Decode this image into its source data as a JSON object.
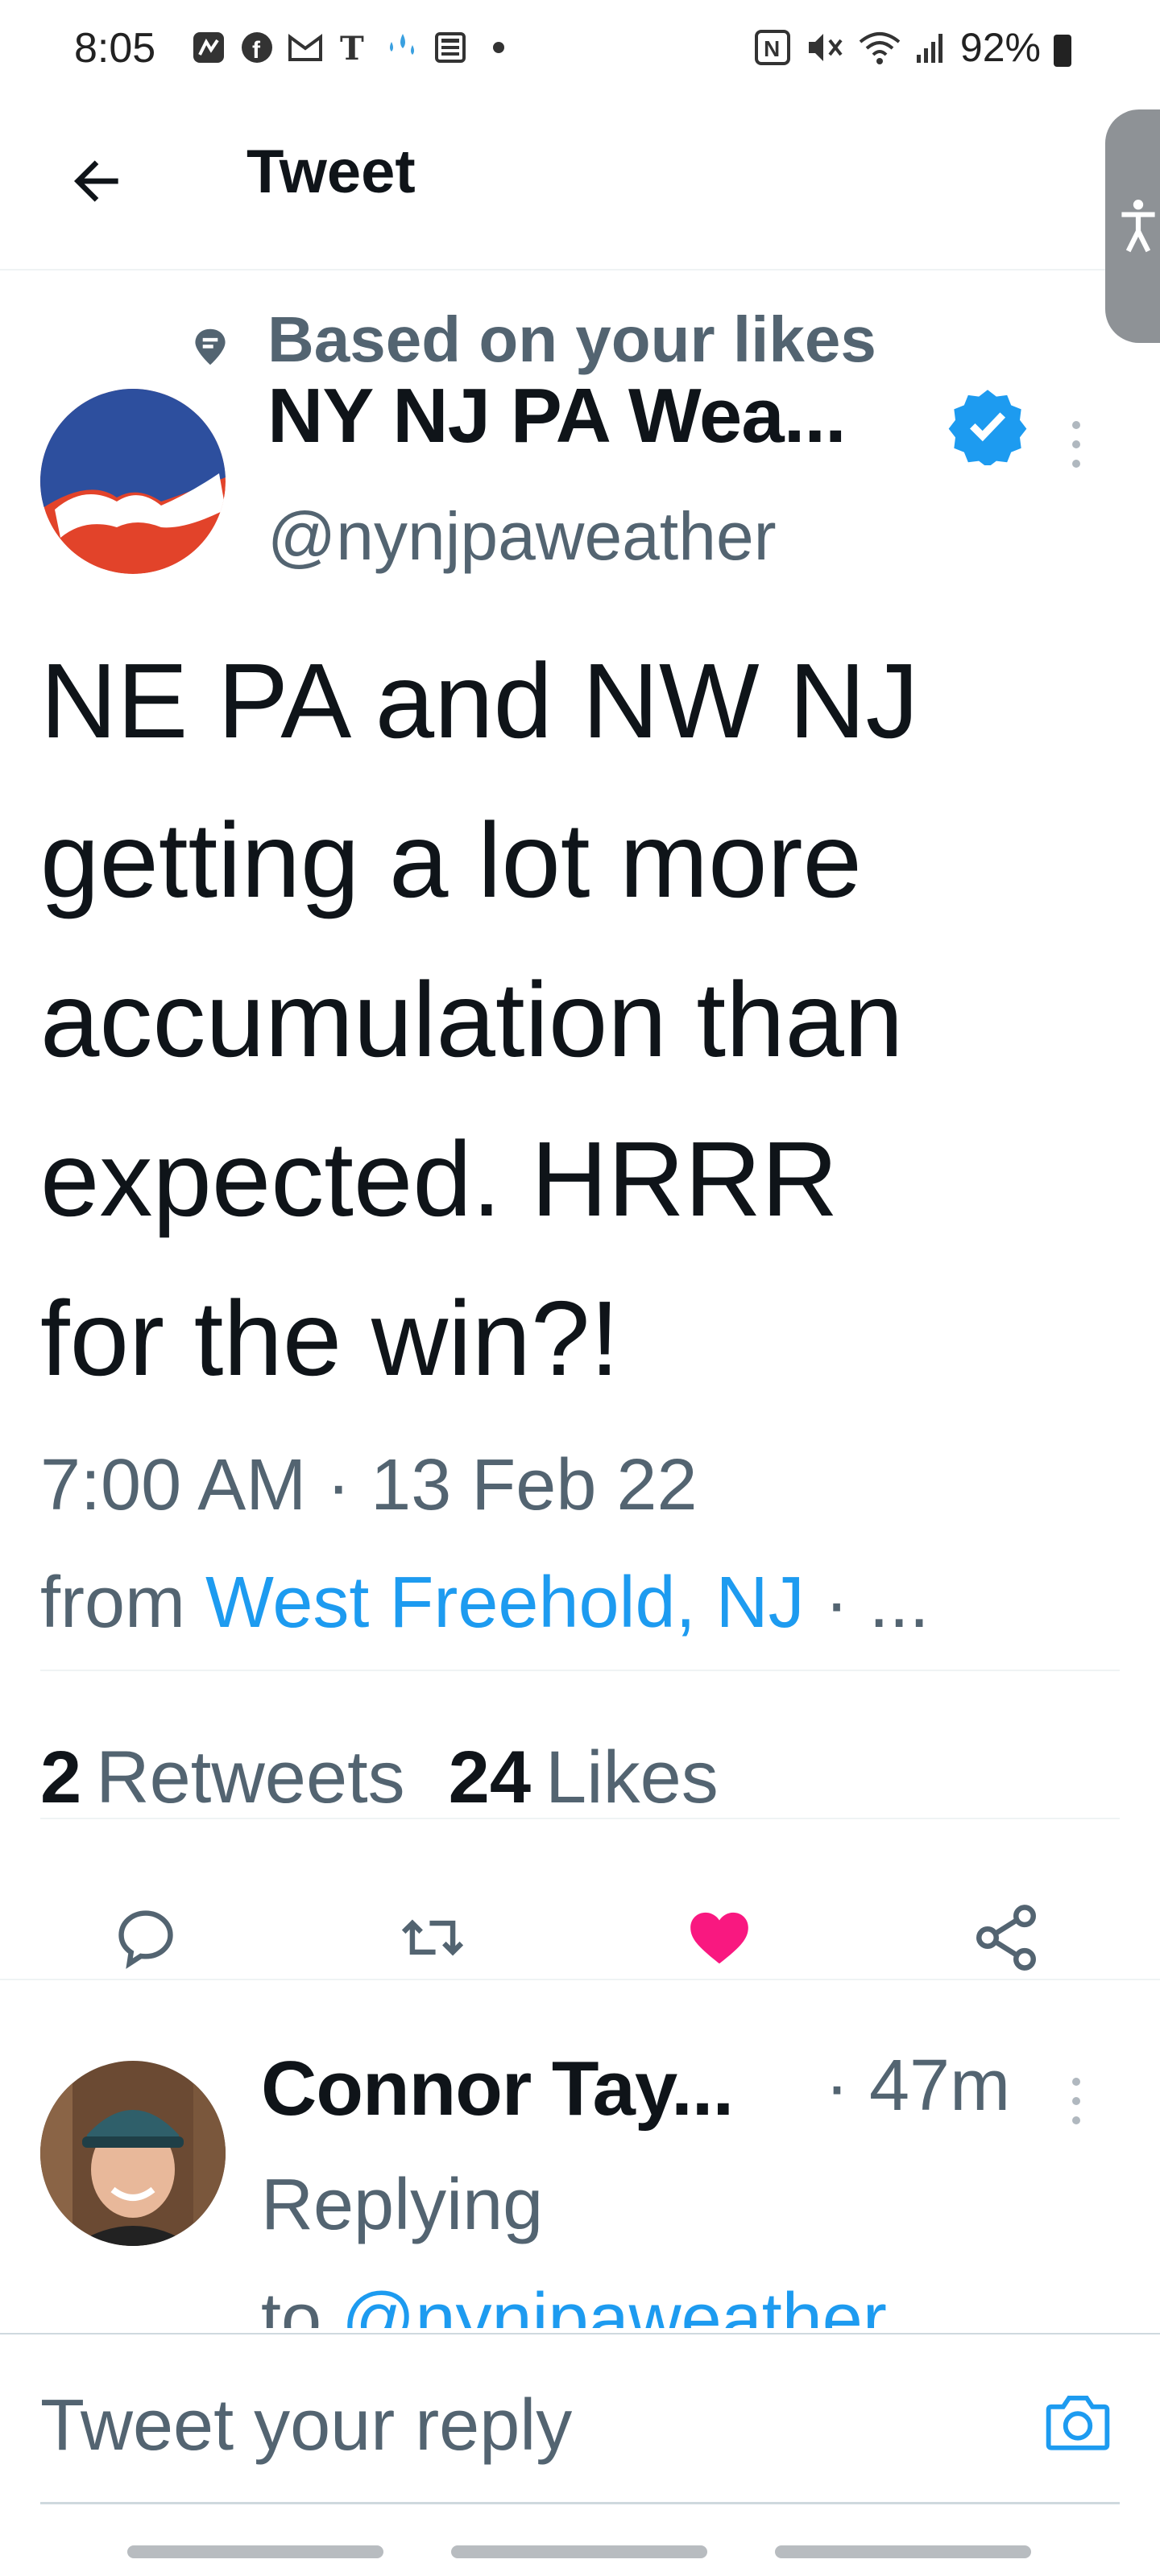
{
  "status_bar": {
    "time": "8:05",
    "battery": "92%",
    "left_icons": [
      "nfc-app-icon",
      "facebook-icon",
      "gmail-icon",
      "nytimes-icon",
      "drops-icon",
      "news-icon",
      "dot-icon"
    ],
    "right_icons": [
      "nfc-icon",
      "mute-icon",
      "wifi-icon",
      "signal-icon",
      "battery-icon"
    ]
  },
  "header": {
    "title": "Tweet"
  },
  "tweet": {
    "social_context": "Based on your likes",
    "author_name": "NY NJ PA Wea...",
    "handle": "@nynjpaweather",
    "text": "NE PA and NW NJ\ngetting a lot more\naccumulation than\nexpected.  HRRR\nfor the win?!",
    "timestamp": "7:00 AM · 13 Feb 22",
    "source_prefix": "from ",
    "source_location": "West Freehold, NJ",
    "source_suffix": " · ...",
    "retweets_count": "2",
    "retweets_label": "Retweets",
    "likes_count": "24",
    "likes_label": "Likes",
    "liked": true
  },
  "reply": {
    "author_name": "Connor Tay...",
    "time": "· 47m",
    "replying_label": "Replying",
    "replying_to_prefix": "to ",
    "replying_to_handle": "@nynjpaweather"
  },
  "composer": {
    "placeholder": "Tweet your reply"
  },
  "colors": {
    "accent": "#1d9bf0",
    "like": "#f91880",
    "text": "#0f1419",
    "secondary": "#536471",
    "avatar_blue": "#2d4f9e",
    "avatar_red": "#e2432a"
  }
}
